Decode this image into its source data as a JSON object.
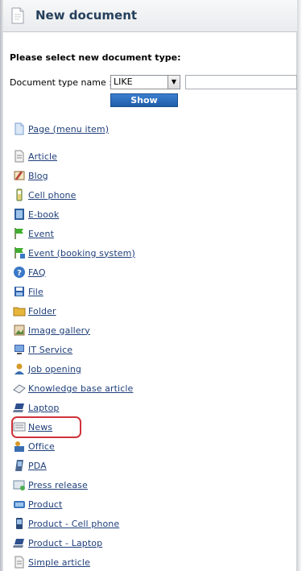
{
  "header": {
    "title": "New document"
  },
  "prompt": "Please select new document type:",
  "filter": {
    "label": "Document type name :",
    "operator": "LIKE",
    "value": "",
    "show_button": "Show"
  },
  "doc_types": [
    {
      "label": "Page (menu item)",
      "icon": "page-icon",
      "color": "#7a9fcf"
    },
    {
      "label": "Article",
      "icon": "article-icon",
      "color": "#8b8b8b"
    },
    {
      "label": "Blog",
      "icon": "blog-icon",
      "color": "#b84a3b"
    },
    {
      "label": "Cell phone",
      "icon": "cell-phone-icon",
      "color": "#4f7a3a"
    },
    {
      "label": "E-book",
      "icon": "ebook-icon",
      "color": "#2e5f9c"
    },
    {
      "label": "Event",
      "icon": "event-flag-icon",
      "color": "#3fae2e"
    },
    {
      "label": "Event (booking system)",
      "icon": "event-booking-icon",
      "color": "#3fae2e"
    },
    {
      "label": "FAQ",
      "icon": "faq-icon",
      "color": "#3a78c8"
    },
    {
      "label": "File",
      "icon": "file-icon",
      "color": "#2f5fa8"
    },
    {
      "label": "Folder",
      "icon": "folder-icon",
      "color": "#e7b53a"
    },
    {
      "label": "Image gallery",
      "icon": "image-gallery-icon",
      "color": "#8c6a3b"
    },
    {
      "label": "IT Service",
      "icon": "it-service-icon",
      "color": "#3c5fa6"
    },
    {
      "label": "Job opening",
      "icon": "job-opening-icon",
      "color": "#d69a2a"
    },
    {
      "label": "Knowledge base article",
      "icon": "knowledge-base-icon",
      "color": "#6d7a8a"
    },
    {
      "label": "Laptop",
      "icon": "laptop-icon",
      "color": "#2d4f8e"
    },
    {
      "label": "News",
      "icon": "news-icon",
      "color": "#8a9098"
    },
    {
      "label": "Office",
      "icon": "office-icon",
      "color": "#3a6eb0"
    },
    {
      "label": "PDA",
      "icon": "pda-icon",
      "color": "#4b6690"
    },
    {
      "label": "Press release",
      "icon": "press-release-icon",
      "color": "#6d8aa0"
    },
    {
      "label": "Product",
      "icon": "product-icon",
      "color": "#3a76c0"
    },
    {
      "label": "Product - Cell phone",
      "icon": "product-cell-phone-icon",
      "color": "#2a4a7a"
    },
    {
      "label": "Product - Laptop",
      "icon": "product-laptop-icon",
      "color": "#2d4f8e"
    },
    {
      "label": "Simple article",
      "icon": "simple-article-icon",
      "color": "#8b8b8b"
    }
  ],
  "highlight_color": "#d0323a"
}
